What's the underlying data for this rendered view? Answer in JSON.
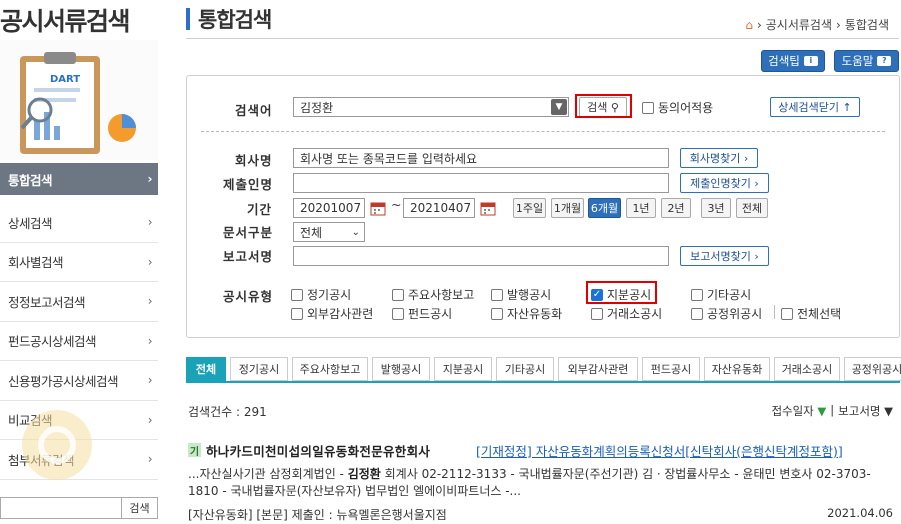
{
  "sidebar": {
    "title": "공시서류검색",
    "logo_text": "DART",
    "items": [
      {
        "label": "통합검색",
        "active": true
      },
      {
        "label": "상세검색"
      },
      {
        "label": "회사별검색"
      },
      {
        "label": "정정보고서검색"
      },
      {
        "label": "펀드공시상세검색"
      },
      {
        "label": "신용평가공시상세검색"
      },
      {
        "label": "비교검색"
      },
      {
        "label": "첨부서류검색"
      }
    ],
    "search_button": "검색"
  },
  "header": {
    "title": "통합검색",
    "breadcrumb": [
      "공시서류검색",
      "통합검색"
    ],
    "tip_button": "검색팁",
    "help_button": "도움말"
  },
  "form": {
    "keyword_label": "검색어",
    "keyword_value": "김정환",
    "search_button": "검색",
    "synonym_label": "동의어적용",
    "detail_toggle": "상세검색닫기",
    "company_label": "회사명",
    "company_placeholder": "회사명 또는 종목코드를 입력하세요",
    "company_find": "회사명찾기",
    "submitter_label": "제출인명",
    "submitter_value": "",
    "submitter_find": "제출인명찾기",
    "period_label": "기간",
    "date_from": "20201007",
    "date_sep": "~",
    "date_to": "20210407",
    "period_buttons": [
      "1주일",
      "1개월",
      "6개월",
      "1년",
      "2년",
      "3년",
      "전체"
    ],
    "period_selected": "6개월",
    "doc_type_label": "문서구분",
    "doc_type_value": "전체",
    "report_label": "보고서명",
    "report_value": "",
    "report_find": "보고서명찾기",
    "disclosure_label": "공시유형",
    "disclosure_types": [
      {
        "label": "정기공시",
        "checked": false
      },
      {
        "label": "주요사항보고",
        "checked": false
      },
      {
        "label": "발행공시",
        "checked": false
      },
      {
        "label": "지분공시",
        "checked": true
      },
      {
        "label": "기타공시",
        "checked": false
      },
      {
        "label": "외부감사관련",
        "checked": false
      },
      {
        "label": "펀드공시",
        "checked": false
      },
      {
        "label": "자산유동화",
        "checked": false
      },
      {
        "label": "거래소공시",
        "checked": false
      },
      {
        "label": "공정위공시",
        "checked": false
      },
      {
        "label": "전체선택",
        "checked": false
      }
    ]
  },
  "tabs": [
    "전체",
    "정기공시",
    "주요사항보고",
    "발행공시",
    "지분공시",
    "기타공시",
    "외부감사관련",
    "펀드공시",
    "자산유동화",
    "거래소공시",
    "공정위공시"
  ],
  "results": {
    "count_label": "검색건수 : 291",
    "sort_date": "접수일자",
    "sort_report": "보고서명",
    "sort_sep": "|",
    "item": {
      "badge": "기",
      "company": "하나카드미천미섭의일유동화전문유한회사",
      "title": "[기재정정] 자산유동화계획의등록신청서[신탁회사(은행신탁계정포함)]",
      "desc_pre": "...자산실사기관 삼정회계법인 - ",
      "desc_bold": "김정환",
      "desc_post": " 회계사 02-2112-3133 - 국내법률자문(주선기관) 김ㆍ장법률사무소 - 윤태민 변호사 02-3703-1810 - 국내법률자문(자산보유자) 법무법인 엘에이비파트너스 -...",
      "meta": "[자산유동화]  [본문]  제출인 : 뉴욕멜론은행서울지점",
      "date": "2021.04.06"
    }
  }
}
